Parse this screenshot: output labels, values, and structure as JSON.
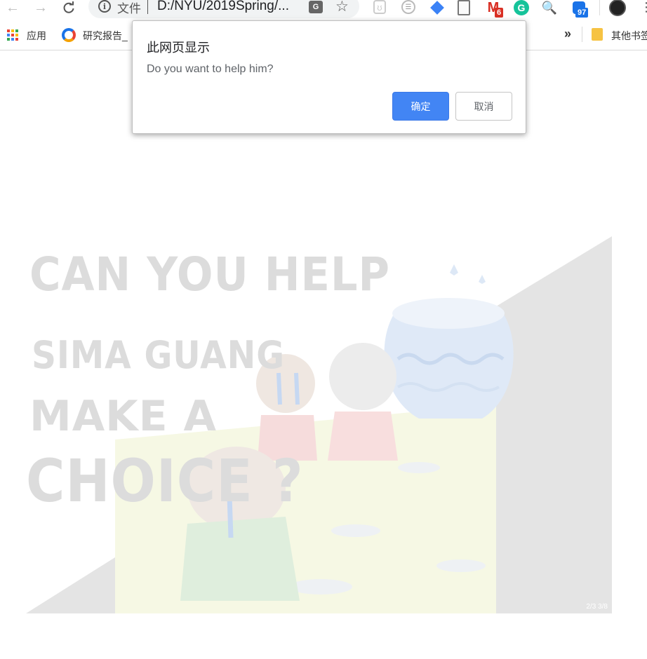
{
  "toolbar": {
    "back_icon": "←",
    "forward_icon": "→",
    "reload_icon": "C",
    "omnibox": {
      "info_glyph": "i",
      "file_label": "文件",
      "url": "D:/NYU/2019Spring/..."
    },
    "translate_glyph": "G",
    "star_icon": "☆",
    "extensions": {
      "gmail_letter": "M",
      "gmail_badge": "6",
      "grammarly_letter": "G",
      "blue_ext_badge": "97"
    },
    "menu_icon": "⋮"
  },
  "bookmarks": {
    "apps_label": "应用",
    "research_label": "研究报告_",
    "overflow_icon": "»",
    "other_label": "其他书签"
  },
  "slide": {
    "title_lines": [
      "CAN YOU HELP",
      "SIMA GUANG",
      "MAKE A",
      "CHOICE ?"
    ],
    "counter": "2/3 3/8"
  },
  "dialog": {
    "title": "此网页显示",
    "message": "Do you want to help him?",
    "ok_label": "确定",
    "cancel_label": "取消"
  },
  "colors": {
    "accent": "#4285f4",
    "gmail_red": "#d93025",
    "grammarly_green": "#15c39a"
  }
}
